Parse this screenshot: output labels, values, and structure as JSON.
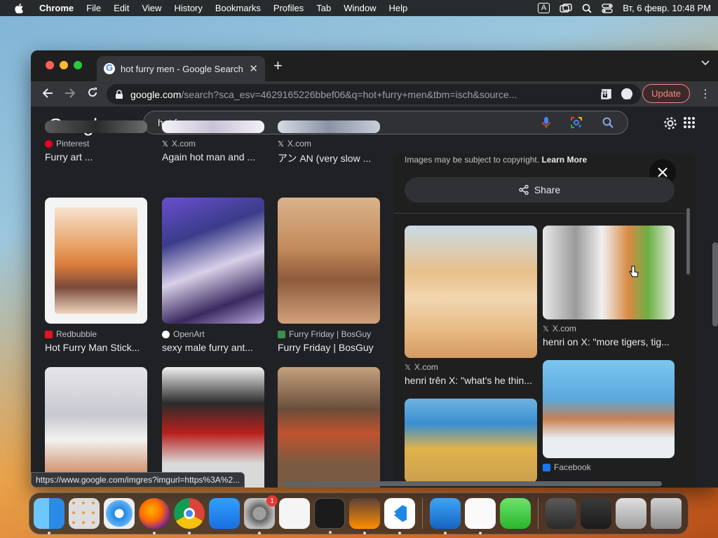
{
  "menubar": {
    "app_name": "Chrome",
    "items": [
      "File",
      "Edit",
      "View",
      "History",
      "Bookmarks",
      "Profiles",
      "Tab",
      "Window",
      "Help"
    ],
    "input_indicator": "A",
    "datetime": "Вт, 6 февр.  10:48 PM"
  },
  "browser": {
    "tab_title": "hot furry men - Google Search",
    "url_host": "google.com",
    "url_rest": "/search?sca_esv=4629165226bbef06&q=hot+furry+men&tbm=isch&source...",
    "update_label": "Update",
    "status_url": "https://www.google.com/imgres?imgurl=https%3A%2..."
  },
  "google": {
    "logo": "Google",
    "query": "hot furry men"
  },
  "results": {
    "row0": [
      {
        "source": "Pinterest",
        "title": "Furry art ...",
        "source_color": "#e60023"
      },
      {
        "source": "X.com",
        "title": "Again hot man and ...",
        "source_color": "#ffffff"
      },
      {
        "source": "X.com",
        "title": "アン AN (very slow ...",
        "source_color": "#ffffff"
      }
    ],
    "row1": [
      {
        "source": "Redbubble",
        "title": "Hot Furry Man Stick...",
        "source_color": "#e41321"
      },
      {
        "source": "OpenArt",
        "title": "sexy male furry ant...",
        "source_color": "#ffffff"
      },
      {
        "source": "Furry Friday | BosGuy",
        "title": "Furry Friday | BosGuy",
        "source_color": "#3d8f4f"
      }
    ]
  },
  "panel": {
    "copyright_text": "Images may be subject to copyright.",
    "learn_more": "Learn More",
    "share_label": "Share",
    "related": [
      {
        "source": "X.com",
        "title": "henri trên X: \"what's he thin..."
      },
      {
        "source": "X.com",
        "title": "henri on X: \"more tigers, tig..."
      },
      {
        "source": "Facebook",
        "title": ""
      }
    ]
  },
  "dock": {
    "settings_badge": "1"
  },
  "colors": {
    "accent_blue": "#8ab4f8",
    "update_red": "#f28b82"
  }
}
